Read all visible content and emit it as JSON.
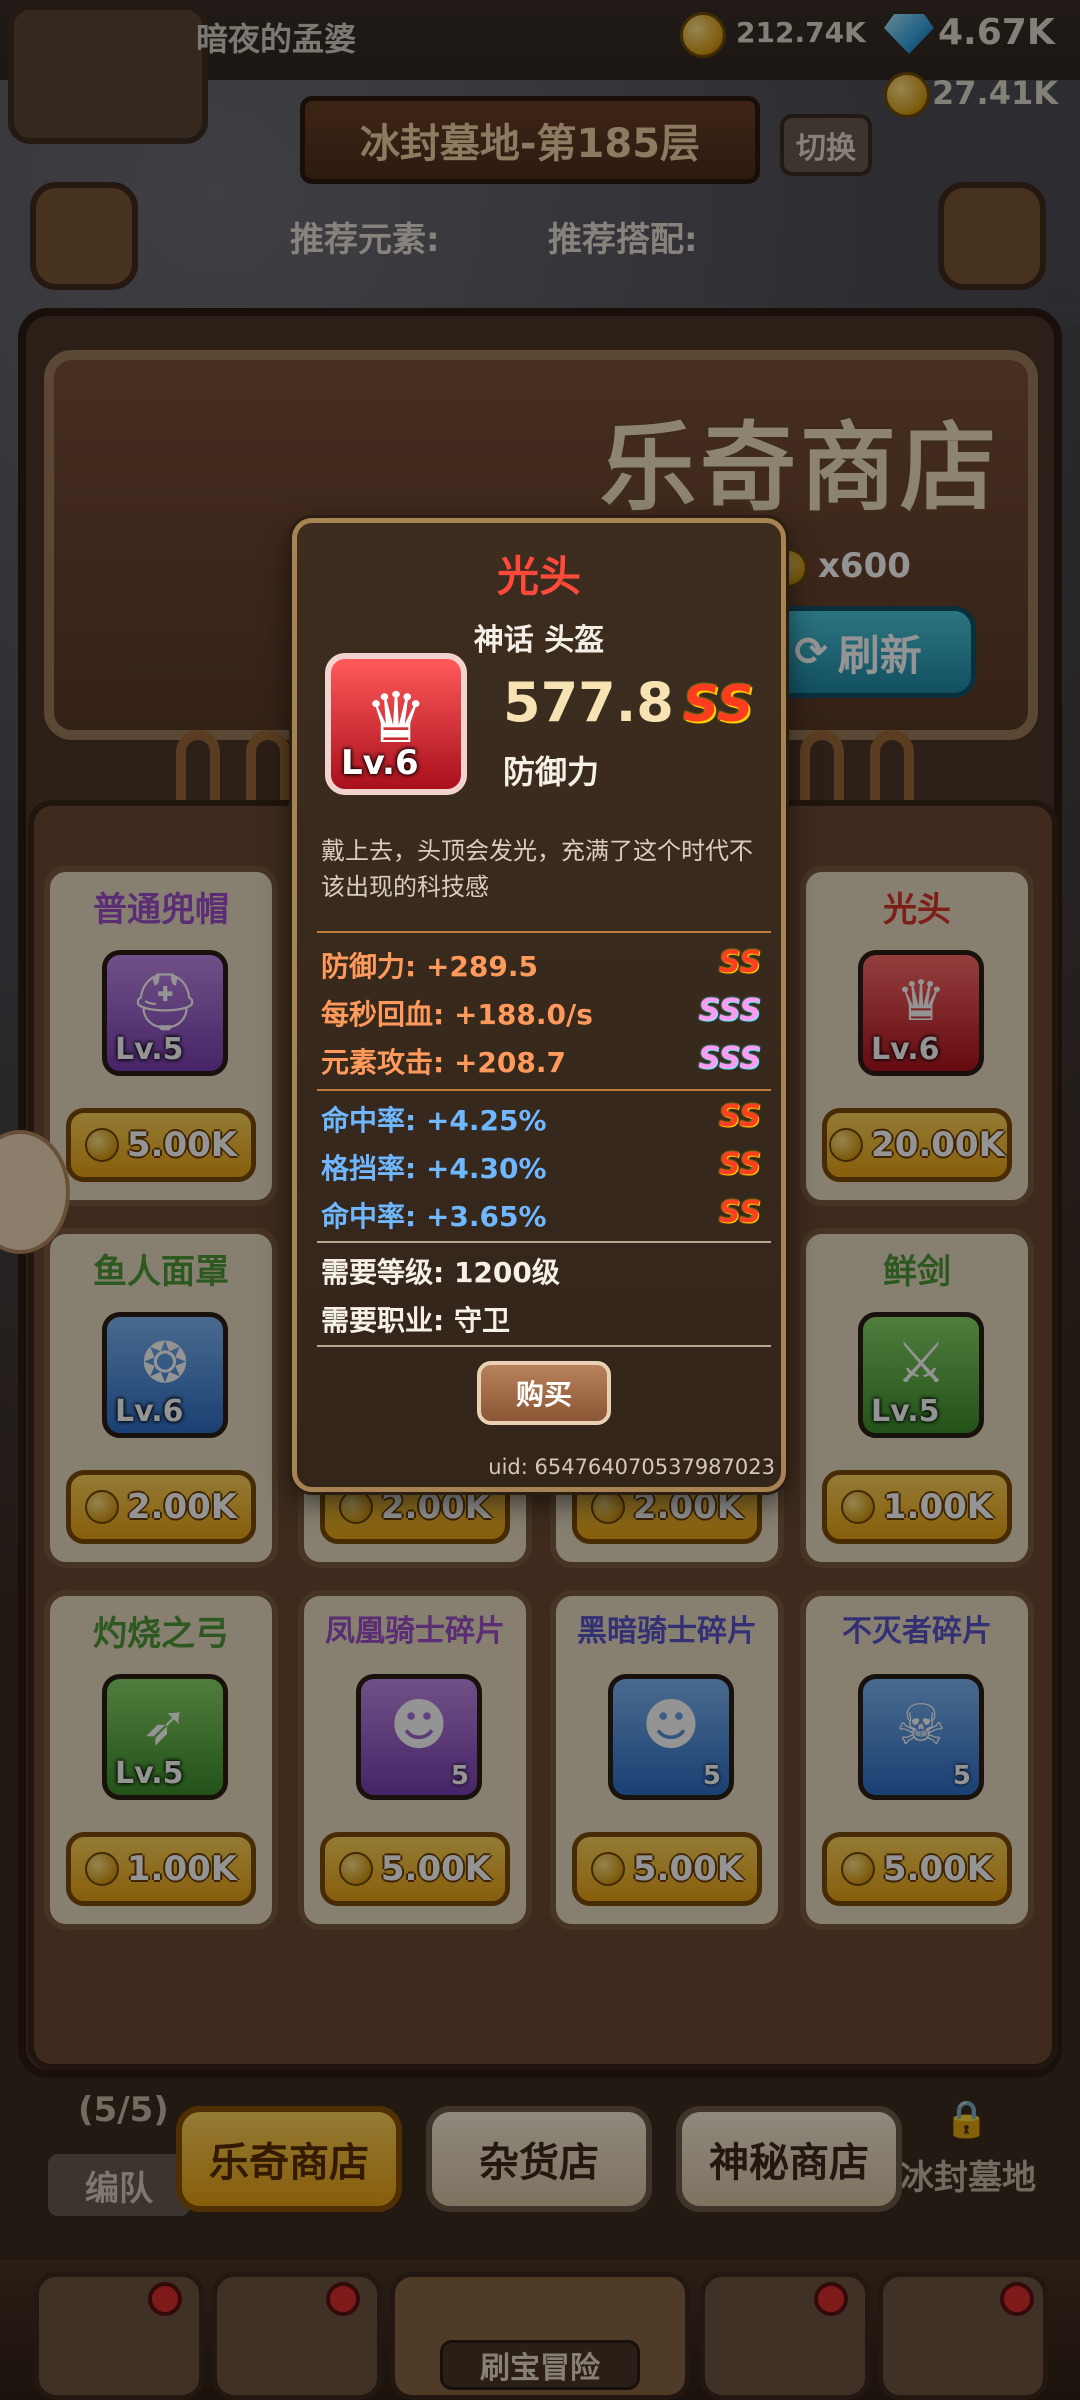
{
  "header": {
    "nickname": "暗夜的孟婆",
    "gold": "212.74K",
    "gems": "4.67K",
    "coins2": "27.41K",
    "stage": "冰封墓地-第185层",
    "switch_label": "切换",
    "recommend_element": "推荐元素:",
    "recommend_combo": "推荐搭配:"
  },
  "shop": {
    "banner_title": "乐奇商店",
    "refresh_cost": "x600",
    "refresh_label": "刷新",
    "cards": [
      {
        "name": "普通兜帽",
        "level": "Lv.5",
        "price": "5.00K",
        "rarity": "purple",
        "icon": "helmet-icon"
      },
      {
        "name": "光头",
        "level": "Lv.6",
        "price": "20.00K",
        "rarity": "red",
        "icon": "crown-icon"
      },
      {
        "name": "鱼人面罩",
        "level": "Lv.6",
        "price": "2.00K",
        "rarity": "blue",
        "icon": "mask-icon"
      },
      {
        "name": "鲜剑",
        "level": "Lv.5",
        "price": "1.00K",
        "rarity": "green",
        "icon": "sword-icon"
      },
      {
        "name": "灼烧之弓",
        "level": "Lv.5",
        "price": "1.00K",
        "rarity": "green",
        "icon": "bow-icon"
      },
      {
        "name": "凤凰骑士碎片",
        "count": "5",
        "price": "5.00K",
        "rarity": "purple",
        "icon": "knight-fragment-icon"
      },
      {
        "name": "黑暗骑士碎片",
        "count": "5",
        "price": "5.00K",
        "rarity": "blue",
        "icon": "dark-knight-fragment-icon"
      },
      {
        "name": "不灭者碎片",
        "count": "5",
        "price": "5.00K",
        "rarity": "blue",
        "icon": "undying-fragment-icon"
      }
    ],
    "hidden_prices": [
      "2.00K",
      "2.00K"
    ]
  },
  "tabs": [
    {
      "label": "乐奇商店",
      "active": true
    },
    {
      "label": "杂货店",
      "active": false
    },
    {
      "label": "神秘商店",
      "active": false
    }
  ],
  "team": {
    "count": "(5/5)",
    "label": "编队",
    "locked_label": "冰封墓地"
  },
  "bottom_nav": {
    "adventure": "刷宝冒险"
  },
  "popup": {
    "title": "光头",
    "subtitle": "神话 头盔",
    "level": "Lv.6",
    "value": "577.8",
    "rank": "SS",
    "stat_name": "防御力",
    "description": "戴上去，头顶会发光，充满了这个时代不该出现的科技感",
    "stats": [
      {
        "label": "防御力: +289.5",
        "grade": "SS",
        "color": "orange"
      },
      {
        "label": "每秒回血: +188.0/s",
        "grade": "SSS",
        "color": "orange"
      },
      {
        "label": "元素攻击: +208.7",
        "grade": "SSS",
        "color": "orange"
      },
      {
        "label": "命中率: +4.25%",
        "grade": "SS",
        "color": "blue"
      },
      {
        "label": "格挡率: +4.30%",
        "grade": "SS",
        "color": "blue"
      },
      {
        "label": "命中率: +3.65%",
        "grade": "SS",
        "color": "blue"
      }
    ],
    "requirements": [
      "需要等级: 1200级",
      "需要职业: 守卫"
    ],
    "buy_label": "购买",
    "uid": "uid: 6547640705379870​23"
  }
}
